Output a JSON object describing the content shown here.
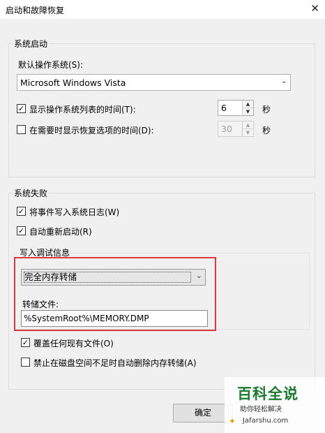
{
  "window": {
    "title": "启动和故障恢复",
    "close_glyph": "✕"
  },
  "system_startup": {
    "legend": "系统启动",
    "default_os_label": "默认操作系统(S):",
    "default_os_value": "Microsoft Windows Vista",
    "show_list": {
      "label": "显示操作系统列表的时间(T):",
      "checked": true,
      "value": "6",
      "unit": "秒"
    },
    "show_recovery": {
      "label": "在需要时显示恢复选项的时间(D):",
      "checked": false,
      "value": "30",
      "unit": "秒"
    }
  },
  "system_failure": {
    "legend": "系统失败",
    "write_event": {
      "label": "将事件写入系统日志(W)",
      "checked": true
    },
    "auto_restart": {
      "label": "自动重新启动(R)",
      "checked": true
    },
    "debug_info": {
      "legend": "写入调试信息",
      "dump_type": "完全内存转储",
      "dump_file_label": "转储文件:",
      "dump_file_value": "%SystemRoot%\\MEMORY.DMP"
    },
    "overwrite": {
      "label": "覆盖任何现有文件(O)",
      "checked": true
    },
    "disable_auto_delete": {
      "label": "禁止在磁盘空间不足时自动删除内存转储(A)",
      "checked": false
    }
  },
  "buttons": {
    "ok": "确定"
  },
  "watermark": {
    "main": "百科全说",
    "sub": "助你轻松解决",
    "site": "Jafarshu.com"
  },
  "colors": {
    "highlight": "#d9363e",
    "watermark_green": "#1a7a2e"
  }
}
